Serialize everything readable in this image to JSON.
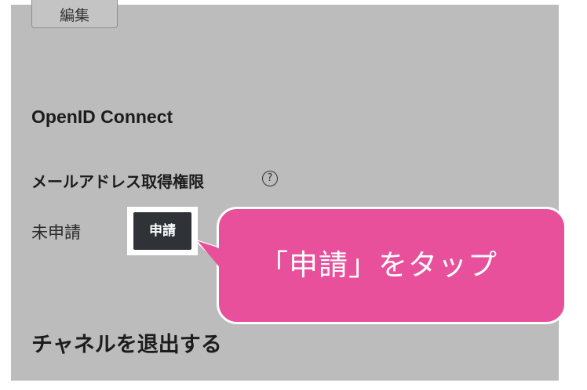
{
  "top": {
    "edit_label": "編集"
  },
  "openid": {
    "section_title": "OpenID Connect",
    "permission_label": "メールアドレス取得権限",
    "help_symbol": "?",
    "status_text": "未申請",
    "apply_label": "申請"
  },
  "channel": {
    "leave_title": "チャネルを退出する"
  },
  "callout": {
    "text": "「申請」をタップ",
    "color": "#e8509b"
  }
}
